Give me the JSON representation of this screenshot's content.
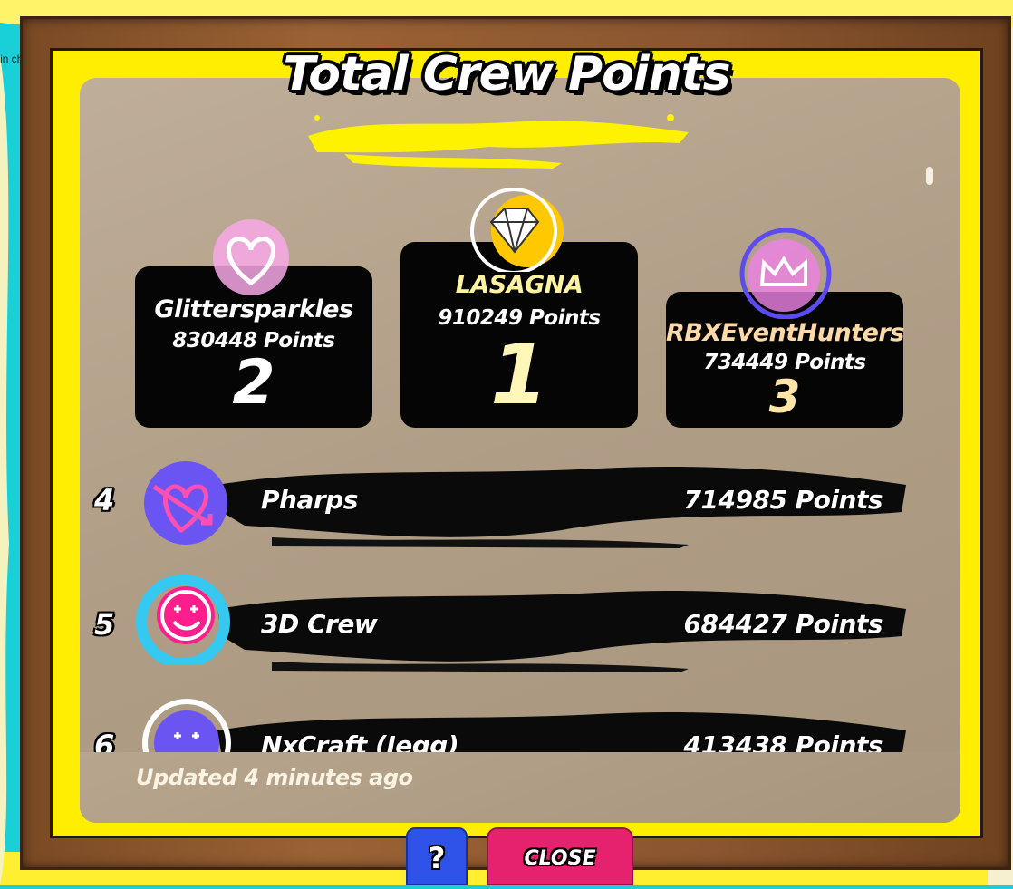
{
  "chat_hint": "in chat",
  "title": "Total Crew Points",
  "podium": [
    {
      "rank": "2",
      "name": "Glittersparkles",
      "points": "830448 Points",
      "name_color": "#ffffff",
      "rank_color": "#ffffff",
      "badge": "heart-icon",
      "badge_color": "#f7a8e6"
    },
    {
      "rank": "1",
      "name": "LASAGNA",
      "points": "910249 Points",
      "name_color": "#fff2a0",
      "rank_color": "#fff6b8",
      "badge": "diamond-icon",
      "badge_color": "#ffc800"
    },
    {
      "rank": "3",
      "name": "RBXEventHunters",
      "points": "734449 Points",
      "name_color": "#ffd9a8",
      "rank_color": "#ffe6a8",
      "badge": "crown-icon",
      "badge_color": "#ee82e6"
    }
  ],
  "rows": [
    {
      "rank": "4",
      "name": "Pharps",
      "points": "714985 Points",
      "icon": "heart-arrow-icon"
    },
    {
      "rank": "5",
      "name": "3D Crew",
      "points": "684427 Points",
      "icon": "smiley-icon"
    },
    {
      "rank": "6",
      "name": "NxCraft (Jegg)",
      "points": "413438 Points",
      "icon": "smiley-icon"
    }
  ],
  "updated": "Updated 4 minutes ago",
  "buttons": {
    "help": "?",
    "close": "CLOSE"
  },
  "colors": {
    "frame": "#8a5530",
    "border_yellow": "#ffee00",
    "panel": "#b5a28b",
    "help": "#2f52e8",
    "close": "#e6226e"
  }
}
